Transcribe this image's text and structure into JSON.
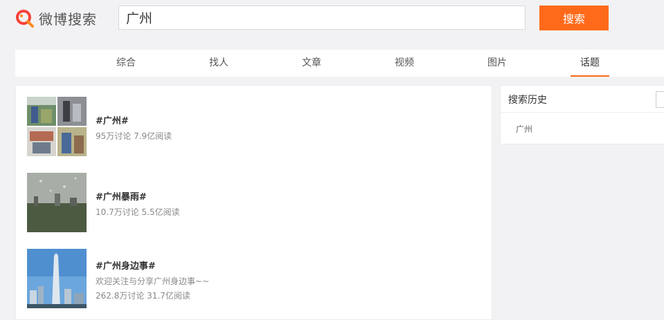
{
  "brand": {
    "name": "微博搜索",
    "accent": "#ff6a1a"
  },
  "search": {
    "value": "广州",
    "button_label": "搜索"
  },
  "tabs": [
    {
      "label": "综合",
      "active": false
    },
    {
      "label": "找人",
      "active": false
    },
    {
      "label": "文章",
      "active": false
    },
    {
      "label": "视频",
      "active": false
    },
    {
      "label": "图片",
      "active": false
    },
    {
      "label": "话题",
      "active": true
    }
  ],
  "topics": [
    {
      "title": "#广州#",
      "stats": "95万讨论 7.9亿阅读"
    },
    {
      "title": "#广州暴雨#",
      "stats": "10.7万讨论 5.5亿阅读"
    },
    {
      "title": "#广州身边事#",
      "desc": "欢迎关注与分享广州身边事~~",
      "stats": "262.8万讨论 31.7亿阅读"
    }
  ],
  "sidebar": {
    "history_title": "搜索历史",
    "history_items": [
      "广州"
    ]
  }
}
